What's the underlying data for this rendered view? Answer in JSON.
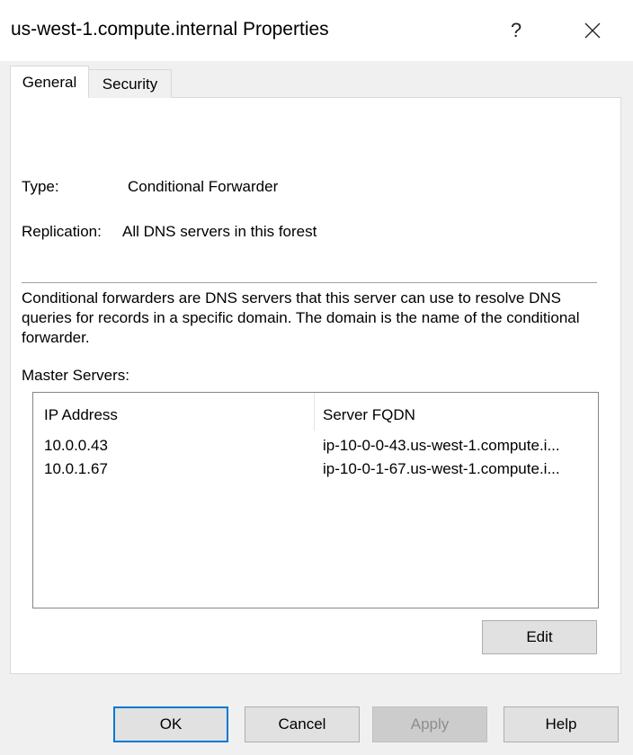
{
  "window": {
    "title": "us-west-1.compute.internal Properties",
    "help_glyph": "?",
    "close_icon": "close-icon"
  },
  "tabs": [
    {
      "label": "General",
      "active": true
    },
    {
      "label": "Security",
      "active": false
    }
  ],
  "general": {
    "type_label": "Type:",
    "type_value": "Conditional Forwarder",
    "replication_label": "Replication:",
    "replication_value": "All DNS servers in this forest",
    "description": "Conditional forwarders are DNS servers that this server can use to resolve DNS queries for records in a specific domain.  The domain is the name of the conditional forwarder.",
    "master_servers_label": "Master Servers:"
  },
  "master_servers": {
    "columns": [
      "IP Address",
      "Server FQDN"
    ],
    "rows": [
      [
        "10.0.0.43",
        "ip-10-0-0-43.us-west-1.compute.i..."
      ],
      [
        "10.0.1.67",
        "ip-10-0-1-67.us-west-1.compute.i..."
      ]
    ]
  },
  "buttons": {
    "edit": "Edit",
    "ok": "OK",
    "cancel": "Cancel",
    "apply": "Apply",
    "help": "Help"
  },
  "colors": {
    "focus_accent": "#0078d7",
    "disabled_text": "#8d8d8d"
  }
}
